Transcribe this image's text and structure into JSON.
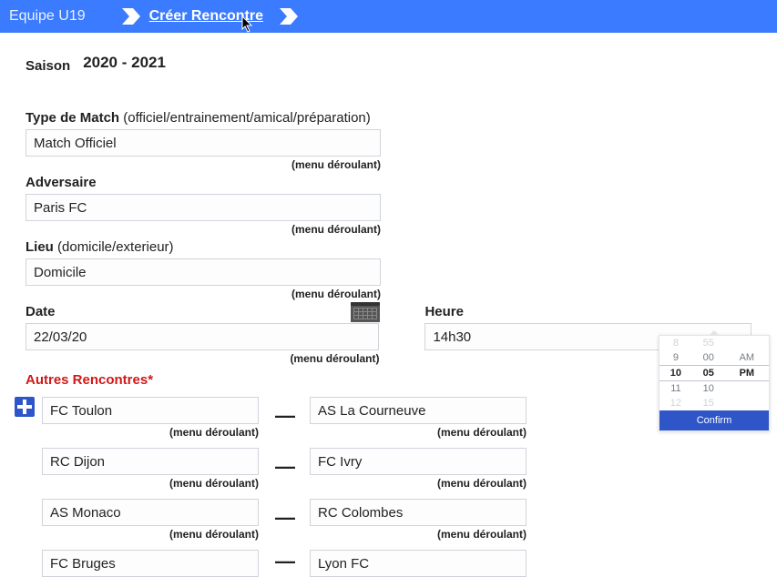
{
  "breadcrumb": {
    "items": [
      {
        "label": "Equipe U19"
      },
      {
        "label": "Créer Rencontre"
      }
    ]
  },
  "season": {
    "label": "Saison",
    "value": "2020 - 2021"
  },
  "notes": {
    "dropdown": "(menu déroulant)"
  },
  "fields": {
    "match_type": {
      "label": "Type de Match",
      "hint": " (officiel/entrainement/amical/préparation)",
      "value": "Match Officiel"
    },
    "opponent": {
      "label": "Adversaire",
      "value": "Paris FC"
    },
    "venue": {
      "label": "Lieu",
      "hint": " (domicile/exterieur)",
      "value": "Domicile"
    },
    "date": {
      "label": "Date",
      "value": "22/03/20"
    },
    "time": {
      "label": "Heure",
      "value": "14h30"
    }
  },
  "other_matches": {
    "title": "Autres Rencontres*",
    "rows": [
      {
        "home": "FC Toulon",
        "away": "AS La Courneuve"
      },
      {
        "home": "RC Dijon",
        "away": "FC Ivry"
      },
      {
        "home": "AS Monaco",
        "away": "RC Colombes"
      },
      {
        "home": "FC Bruges",
        "away": "Lyon FC"
      }
    ]
  },
  "time_picker": {
    "rows": [
      {
        "h": "8",
        "m": "55",
        "ap": ""
      },
      {
        "h": "9",
        "m": "00",
        "ap": "AM"
      },
      {
        "h": "10",
        "m": "05",
        "ap": "PM"
      },
      {
        "h": "11",
        "m": "10",
        "ap": ""
      },
      {
        "h": "12",
        "m": "15",
        "ap": ""
      }
    ],
    "selected_index": 2,
    "confirm": "Confirm"
  }
}
